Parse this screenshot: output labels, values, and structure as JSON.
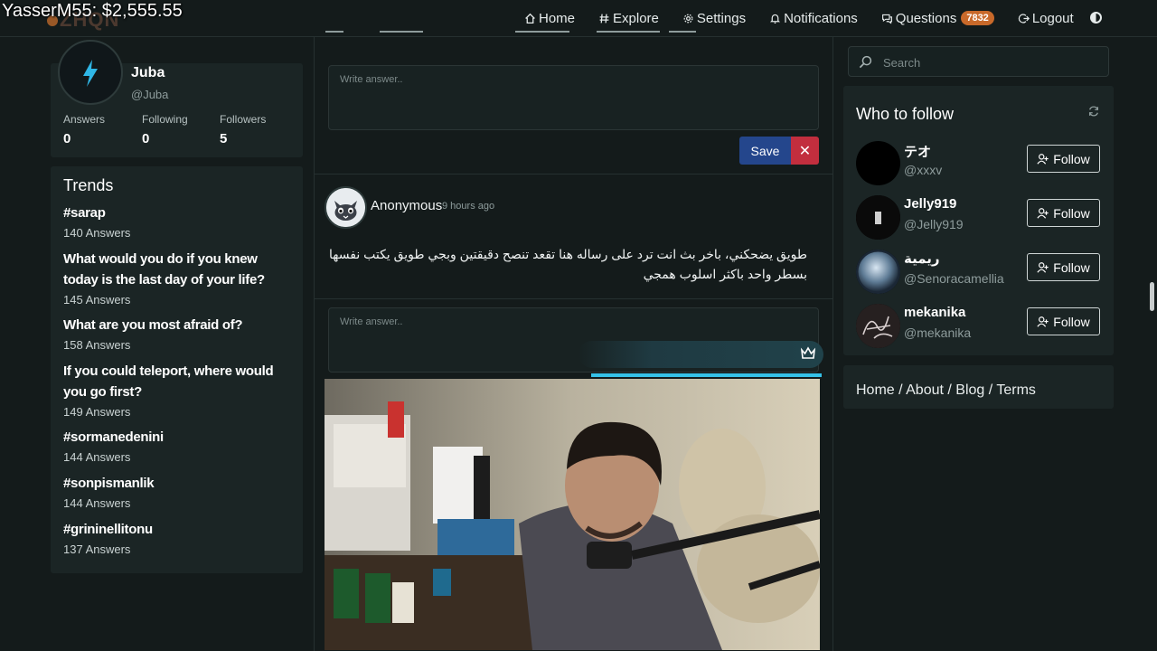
{
  "overlay": {
    "text": "YasserM55: $2,555.55"
  },
  "brand": {
    "name": "ZHQN"
  },
  "nav": {
    "home": "Home",
    "explore": "Explore",
    "settings": "Settings",
    "notifications": "Notifications",
    "questions": "Questions",
    "questions_count": "7832",
    "logout": "Logout"
  },
  "profile": {
    "name": "Juba",
    "handle": "@Juba",
    "stats": [
      {
        "label": "Answers",
        "value": "0"
      },
      {
        "label": "Following",
        "value": "0"
      },
      {
        "label": "Followers",
        "value": "5"
      }
    ]
  },
  "trends": {
    "title": "Trends",
    "items": [
      {
        "title": "#sarap",
        "count": "140 Answers"
      },
      {
        "title": "What would you do if you knew today is the last day of your life?",
        "count": "145 Answers"
      },
      {
        "title": "What are you most afraid of?",
        "count": "158 Answers"
      },
      {
        "title": "If you could teleport, where would you go first?",
        "count": "149 Answers"
      },
      {
        "title": "#sormanedenini",
        "count": "144 Answers"
      },
      {
        "title": "#sonpismanlik",
        "count": "144 Answers"
      },
      {
        "title": "#grininellitonu",
        "count": "137 Answers"
      }
    ]
  },
  "feed": {
    "answer_placeholder": "Write answer..",
    "save_label": "Save",
    "cancel_label": "✕",
    "post": {
      "author": "Anonymous",
      "time": "9 hours ago",
      "body": "طويق يضحكني، باخر بث انت ترد على رساله هنا تقعد تنصح دقيقتين وبجي طويق يكتب نفسها بسطر واحد باكثر اسلوب همجي"
    }
  },
  "search": {
    "placeholder": "Search"
  },
  "who_to_follow": {
    "title": "Who to follow",
    "follow_label": "Follow",
    "users": [
      {
        "name": "テオ",
        "handle": "@xxxv"
      },
      {
        "name": "Jelly919",
        "handle": "@Jelly919"
      },
      {
        "name": "ريمية",
        "handle": "@Senoracamellia"
      },
      {
        "name": "mekanika",
        "handle": "@mekanika"
      }
    ]
  },
  "footer": {
    "links": "Home / About / Blog / Terms"
  },
  "colors": {
    "accent": "#c8692a",
    "save": "#24468c",
    "cancel": "#c22e3e",
    "stream_accent": "#35c2e8"
  }
}
